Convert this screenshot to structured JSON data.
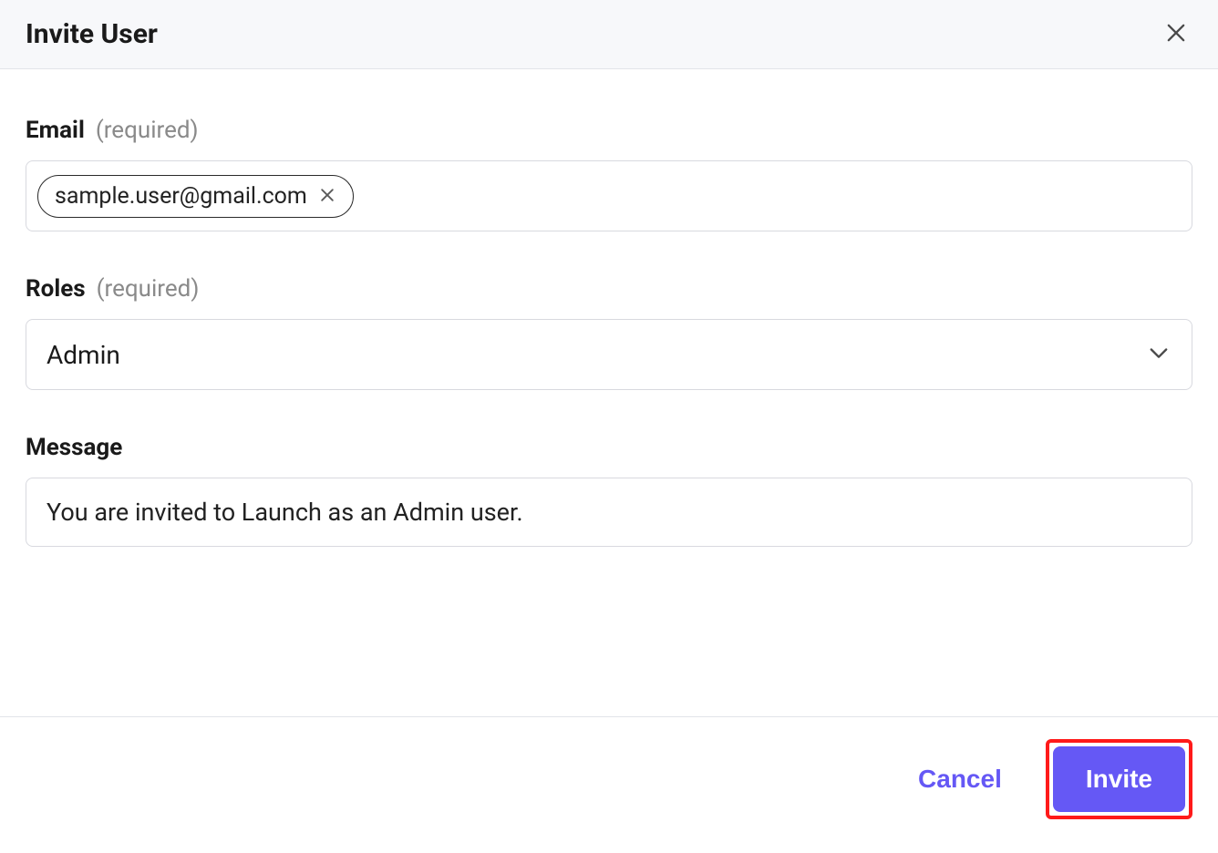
{
  "header": {
    "title": "Invite User"
  },
  "form": {
    "email": {
      "label": "Email",
      "required_text": "(required)",
      "chip_value": "sample.user@gmail.com"
    },
    "roles": {
      "label": "Roles",
      "required_text": "(required)",
      "selected": "Admin"
    },
    "message": {
      "label": "Message",
      "value": "You are invited to Launch as an Admin user."
    }
  },
  "footer": {
    "cancel_label": "Cancel",
    "invite_label": "Invite"
  }
}
